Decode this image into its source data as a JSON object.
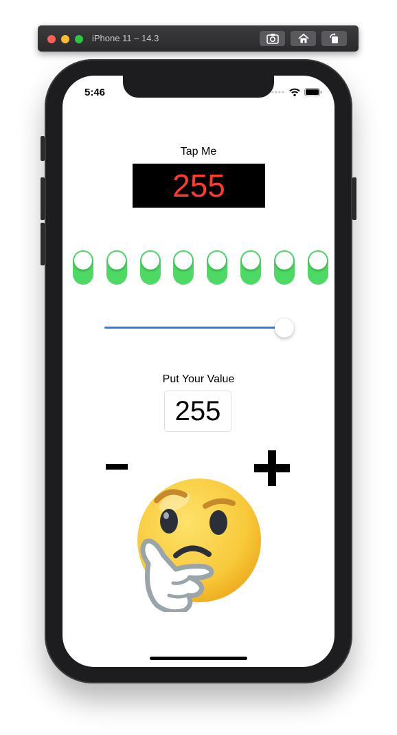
{
  "simulator": {
    "title": "iPhone 11 – 14.3",
    "buttons": [
      "screenshot-icon",
      "home-icon",
      "rotate-icon"
    ]
  },
  "status_bar": {
    "time": "5:46"
  },
  "app": {
    "tap_label": "Tap Me",
    "display_value": "255",
    "display_color": "#ff3b30",
    "toggles": [
      true,
      true,
      true,
      true,
      true,
      true,
      true,
      true
    ],
    "toggle_color": "#4cd964",
    "slider": {
      "value": 1.0,
      "color": "#3478f6"
    },
    "value_label": "Put Your Value",
    "value_input": "255",
    "minus_icon": "minus-icon",
    "plus_icon": "plus-icon",
    "emoji": "thinking-face-emoji"
  }
}
